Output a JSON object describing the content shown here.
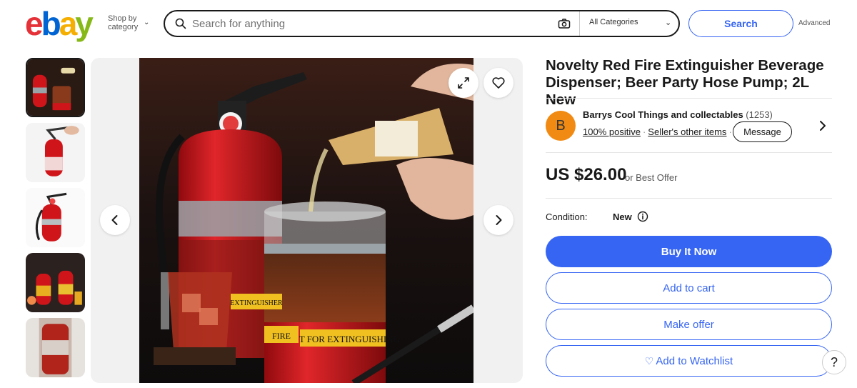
{
  "header": {
    "logo_letters": [
      "e",
      "b",
      "a",
      "y"
    ],
    "shop_by_line1": "Shop by",
    "shop_by_line2": "category",
    "search_placeholder": "Search for anything",
    "category": "All Categories",
    "search_button": "Search",
    "advanced_link": "Advanced"
  },
  "gallery": {
    "thumbnails": [
      {
        "icon": "extinguisher-dispenser-thumb",
        "selected": true
      },
      {
        "icon": "hand-pump-thumb",
        "selected": false
      },
      {
        "icon": "product-white-thumb",
        "selected": false
      },
      {
        "icon": "two-dispensers-thumb",
        "selected": false
      },
      {
        "icon": "extinguisher-closeup-thumb",
        "selected": false
      }
    ]
  },
  "product": {
    "title": "Novelty Red Fire Extinguisher Beverage Dispenser; Beer Party Hose Pump; 2L New",
    "image_labels": [
      "EXTINGUISHER",
      "NOT FOR EXTINGUISHING",
      "FIRE"
    ],
    "seller": {
      "initial": "B",
      "name": "Barrys Cool Things and collectables",
      "feedback_count": "(1253)",
      "positive": "100% positive",
      "other_items": "Seller's other items",
      "message_button": "Message"
    },
    "price": "US $26.00",
    "price_suffix": "or Best Offer",
    "condition_label": "Condition:",
    "condition_value": "New",
    "buttons": {
      "buy_now": "Buy It Now",
      "add_to_cart": "Add to cart",
      "make_offer": "Make offer",
      "watchlist": "Add to Watchlist"
    }
  },
  "help_label": "?",
  "colors": {
    "accent": "#3665f3",
    "avatar": "#f18a12",
    "extinguisher_red": "#d0151a"
  }
}
